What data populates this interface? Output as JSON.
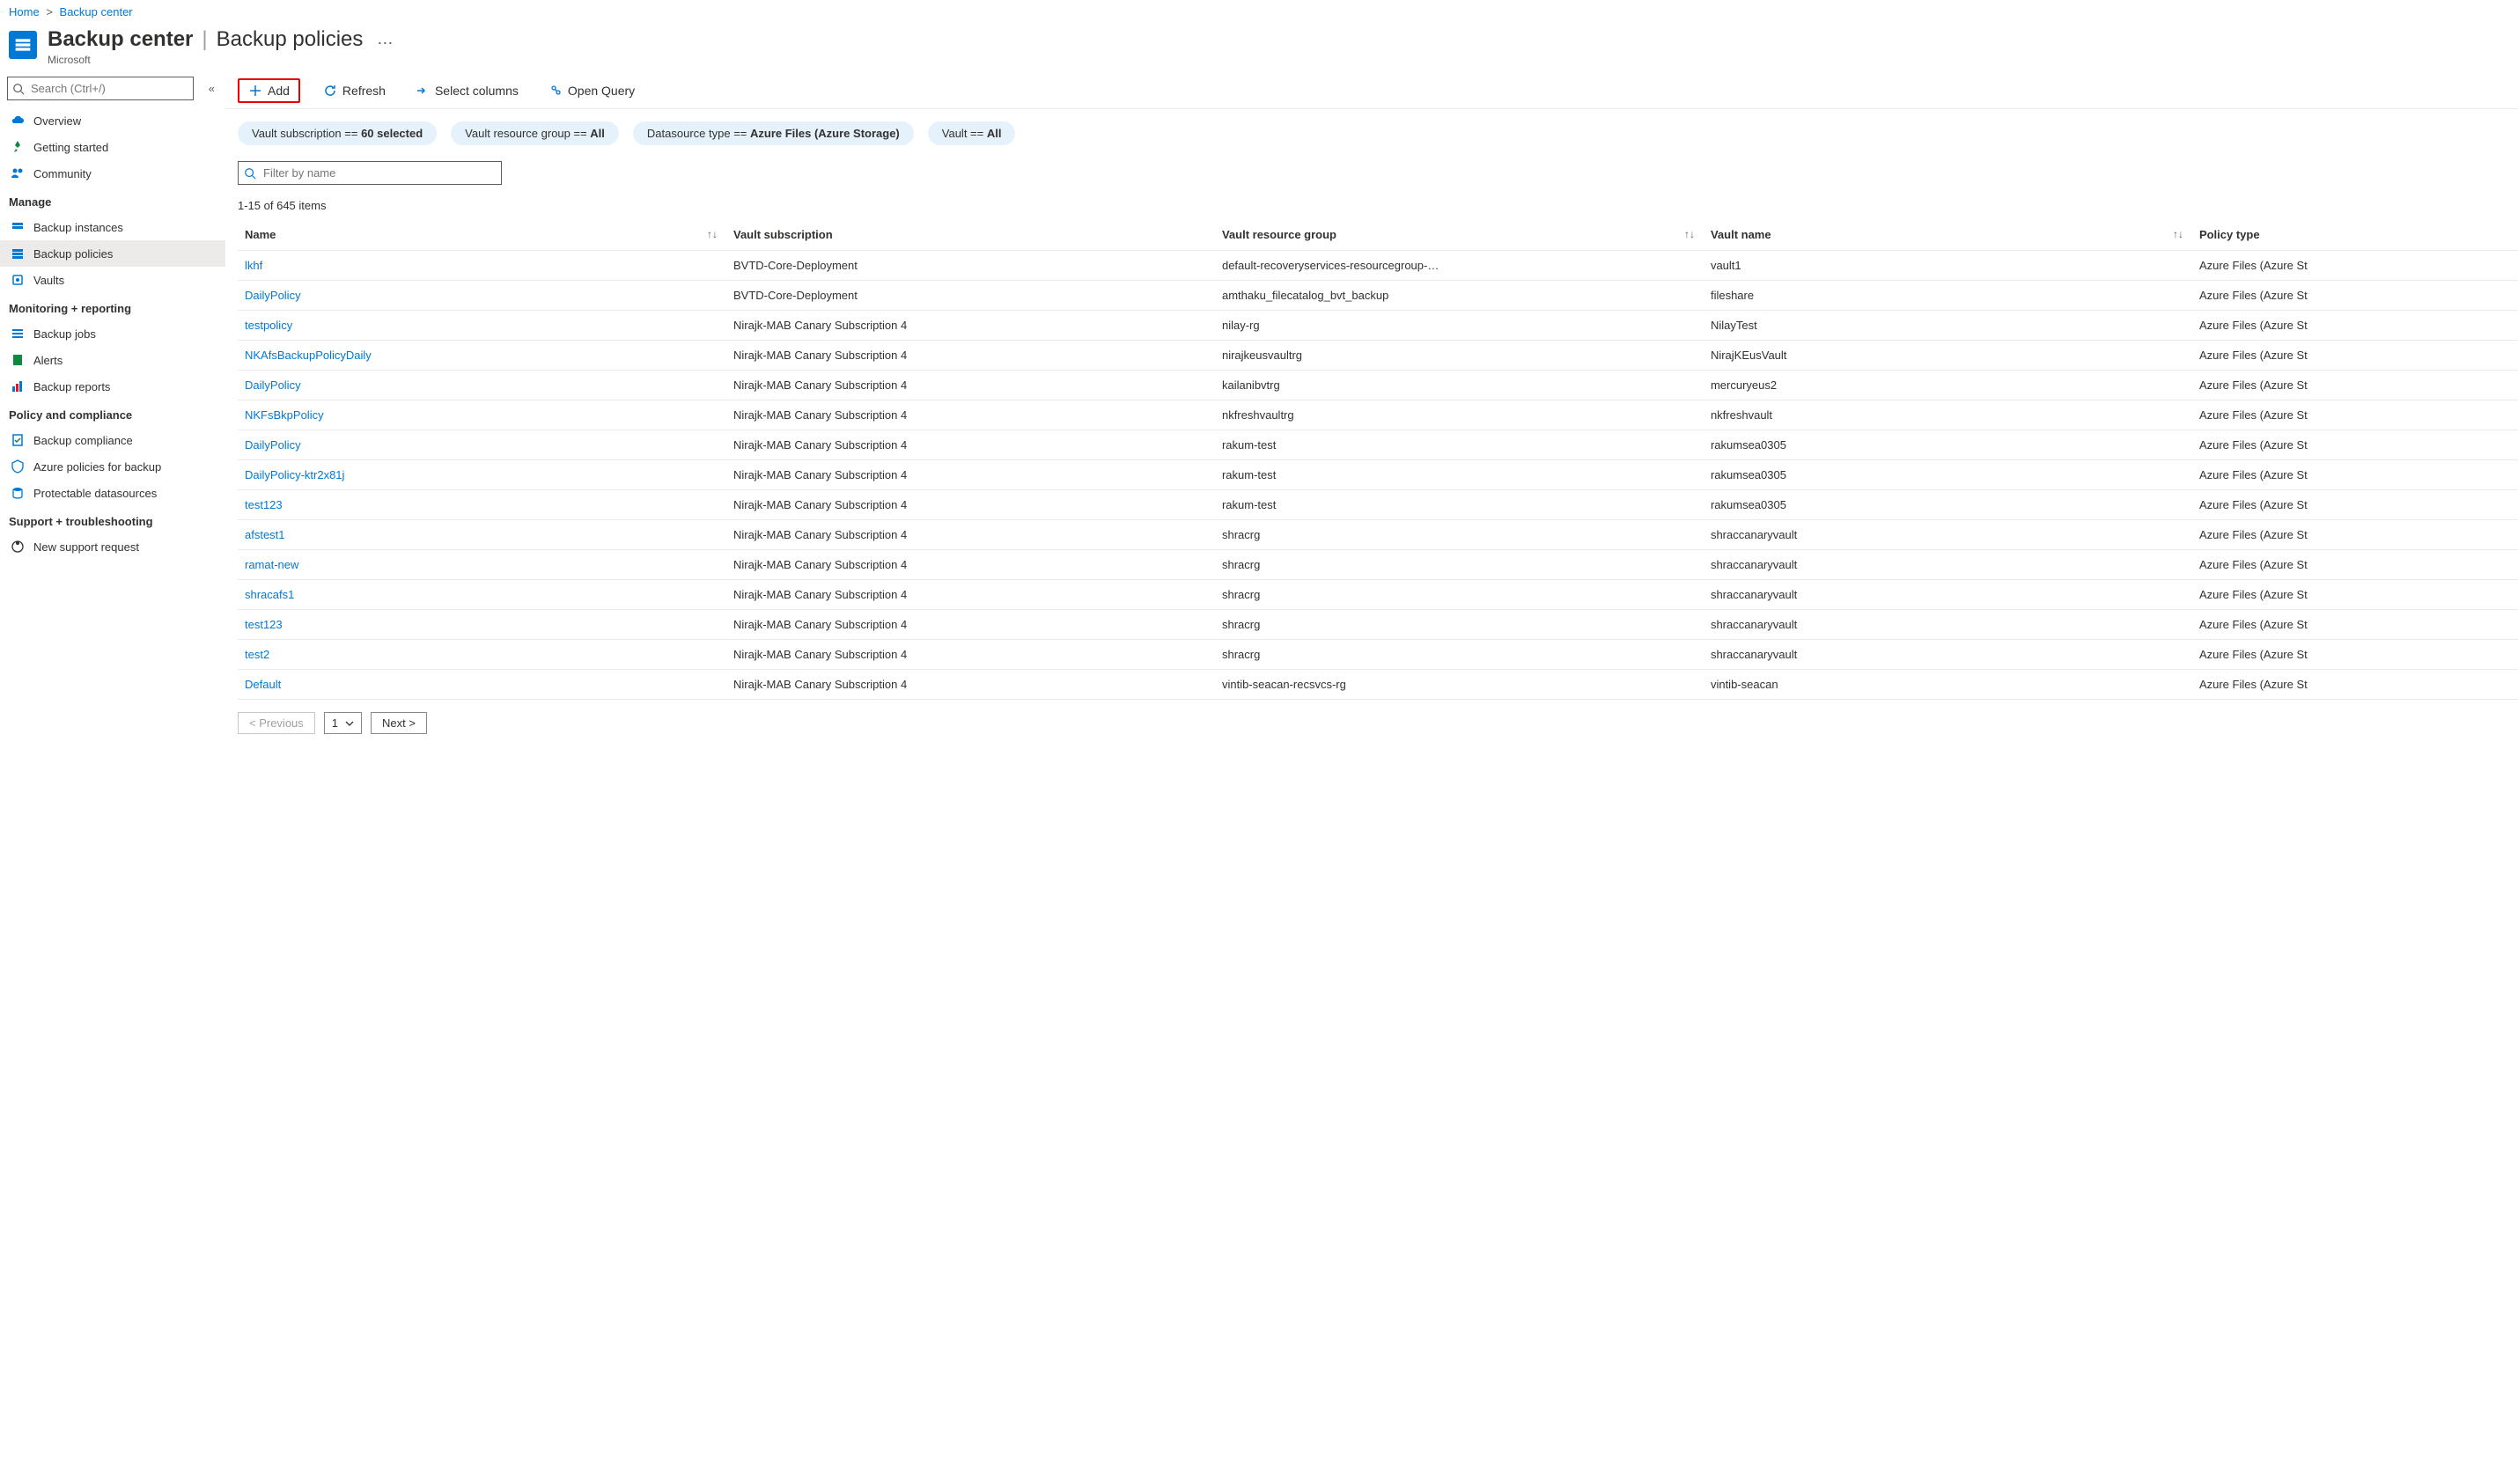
{
  "breadcrumb": {
    "home": "Home",
    "current": "Backup center"
  },
  "header": {
    "title": "Backup center",
    "subtitle": "Backup policies",
    "org": "Microsoft"
  },
  "sidebar": {
    "search_placeholder": "Search (Ctrl+/)",
    "items_top": [
      {
        "label": "Overview"
      },
      {
        "label": "Getting started"
      },
      {
        "label": "Community"
      }
    ],
    "section_manage": "Manage",
    "items_manage": [
      {
        "label": "Backup instances"
      },
      {
        "label": "Backup policies"
      },
      {
        "label": "Vaults"
      }
    ],
    "section_monitoring": "Monitoring + reporting",
    "items_monitoring": [
      {
        "label": "Backup jobs"
      },
      {
        "label": "Alerts"
      },
      {
        "label": "Backup reports"
      }
    ],
    "section_policy": "Policy and compliance",
    "items_policy": [
      {
        "label": "Backup compliance"
      },
      {
        "label": "Azure policies for backup"
      },
      {
        "label": "Protectable datasources"
      }
    ],
    "section_support": "Support + troubleshooting",
    "items_support": [
      {
        "label": "New support request"
      }
    ]
  },
  "toolbar": {
    "add": "Add",
    "refresh": "Refresh",
    "select_columns": "Select columns",
    "open_query": "Open Query"
  },
  "filters": {
    "f1_label": "Vault subscription == ",
    "f1_value": "60 selected",
    "f2_label": "Vault resource group == ",
    "f2_value": "All",
    "f3_label": "Datasource type == ",
    "f3_value": "Azure Files (Azure Storage)",
    "f4_label": "Vault == ",
    "f4_value": "All"
  },
  "filter_placeholder": "Filter by name",
  "count_text": "1-15 of 645 items",
  "columns": {
    "name": "Name",
    "subscription": "Vault subscription",
    "rg": "Vault resource group",
    "vault": "Vault name",
    "policy": "Policy type"
  },
  "rows": [
    {
      "name": "lkhf",
      "sub": "BVTD-Core-Deployment",
      "rg": "default-recoveryservices-resourcegroup-…",
      "vault": "vault1",
      "policy": "Azure Files (Azure St"
    },
    {
      "name": "DailyPolicy",
      "sub": "BVTD-Core-Deployment",
      "rg": "amthaku_filecatalog_bvt_backup",
      "vault": "fileshare",
      "policy": "Azure Files (Azure St"
    },
    {
      "name": "testpolicy",
      "sub": "Nirajk-MAB Canary Subscription 4",
      "rg": "nilay-rg",
      "vault": "NilayTest",
      "policy": "Azure Files (Azure St"
    },
    {
      "name": "NKAfsBackupPolicyDaily",
      "sub": "Nirajk-MAB Canary Subscription 4",
      "rg": "nirajkeusvaultrg",
      "vault": "NirajKEusVault",
      "policy": "Azure Files (Azure St"
    },
    {
      "name": "DailyPolicy",
      "sub": "Nirajk-MAB Canary Subscription 4",
      "rg": "kailanibvtrg",
      "vault": "mercuryeus2",
      "policy": "Azure Files (Azure St"
    },
    {
      "name": "NKFsBkpPolicy",
      "sub": "Nirajk-MAB Canary Subscription 4",
      "rg": "nkfreshvaultrg",
      "vault": "nkfreshvault",
      "policy": "Azure Files (Azure St"
    },
    {
      "name": "DailyPolicy",
      "sub": "Nirajk-MAB Canary Subscription 4",
      "rg": "rakum-test",
      "vault": "rakumsea0305",
      "policy": "Azure Files (Azure St"
    },
    {
      "name": "DailyPolicy-ktr2x81j",
      "sub": "Nirajk-MAB Canary Subscription 4",
      "rg": "rakum-test",
      "vault": "rakumsea0305",
      "policy": "Azure Files (Azure St"
    },
    {
      "name": "test123",
      "sub": "Nirajk-MAB Canary Subscription 4",
      "rg": "rakum-test",
      "vault": "rakumsea0305",
      "policy": "Azure Files (Azure St"
    },
    {
      "name": "afstest1",
      "sub": "Nirajk-MAB Canary Subscription 4",
      "rg": "shracrg",
      "vault": "shraccanaryvault",
      "policy": "Azure Files (Azure St"
    },
    {
      "name": "ramat-new",
      "sub": "Nirajk-MAB Canary Subscription 4",
      "rg": "shracrg",
      "vault": "shraccanaryvault",
      "policy": "Azure Files (Azure St"
    },
    {
      "name": "shracafs1",
      "sub": "Nirajk-MAB Canary Subscription 4",
      "rg": "shracrg",
      "vault": "shraccanaryvault",
      "policy": "Azure Files (Azure St"
    },
    {
      "name": "test123",
      "sub": "Nirajk-MAB Canary Subscription 4",
      "rg": "shracrg",
      "vault": "shraccanaryvault",
      "policy": "Azure Files (Azure St"
    },
    {
      "name": "test2",
      "sub": "Nirajk-MAB Canary Subscription 4",
      "rg": "shracrg",
      "vault": "shraccanaryvault",
      "policy": "Azure Files (Azure St"
    },
    {
      "name": "Default",
      "sub": "Nirajk-MAB Canary Subscription 4",
      "rg": "vintib-seacan-recsvcs-rg",
      "vault": "vintib-seacan",
      "policy": "Azure Files (Azure St"
    }
  ],
  "pager": {
    "prev": "< Previous",
    "page": "1",
    "next": "Next >"
  }
}
